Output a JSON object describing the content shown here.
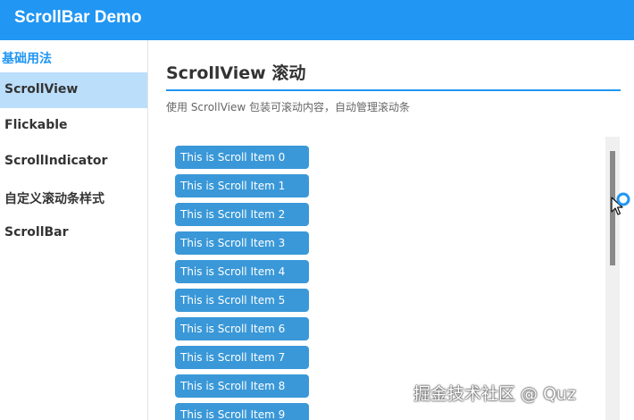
{
  "app": {
    "title": "ScrollBar Demo"
  },
  "sidebar": {
    "section_header": "基础用法",
    "items": [
      {
        "label": "ScrollView",
        "active": true
      },
      {
        "label": "Flickable",
        "active": false
      },
      {
        "label": "ScrollIndicator",
        "active": false
      },
      {
        "label": "自定义滚动条样式",
        "active": false
      },
      {
        "label": "ScrollBar",
        "active": false
      }
    ]
  },
  "main": {
    "heading": "ScrollView 滚动",
    "description": "使用 ScrollView 包装可滚动内容，自动管理滚动条",
    "scroll_items": [
      "This is Scroll Item 0",
      "This is Scroll Item 1",
      "This is Scroll Item 2",
      "This is Scroll Item 3",
      "This is Scroll Item 4",
      "This is Scroll Item 5",
      "This is Scroll Item 6",
      "This is Scroll Item 7",
      "This is Scroll Item 8",
      "This is Scroll Item 9"
    ],
    "scrollbar_position": 0.0
  },
  "watermark": "掘金技术社区 @ Quz",
  "colors": {
    "accent": "#2196f3",
    "item_fill": "#3a98d8",
    "active_item_bg": "#bbdefb",
    "thumb": "#8a8a8a",
    "track": "#f0f0f0"
  }
}
